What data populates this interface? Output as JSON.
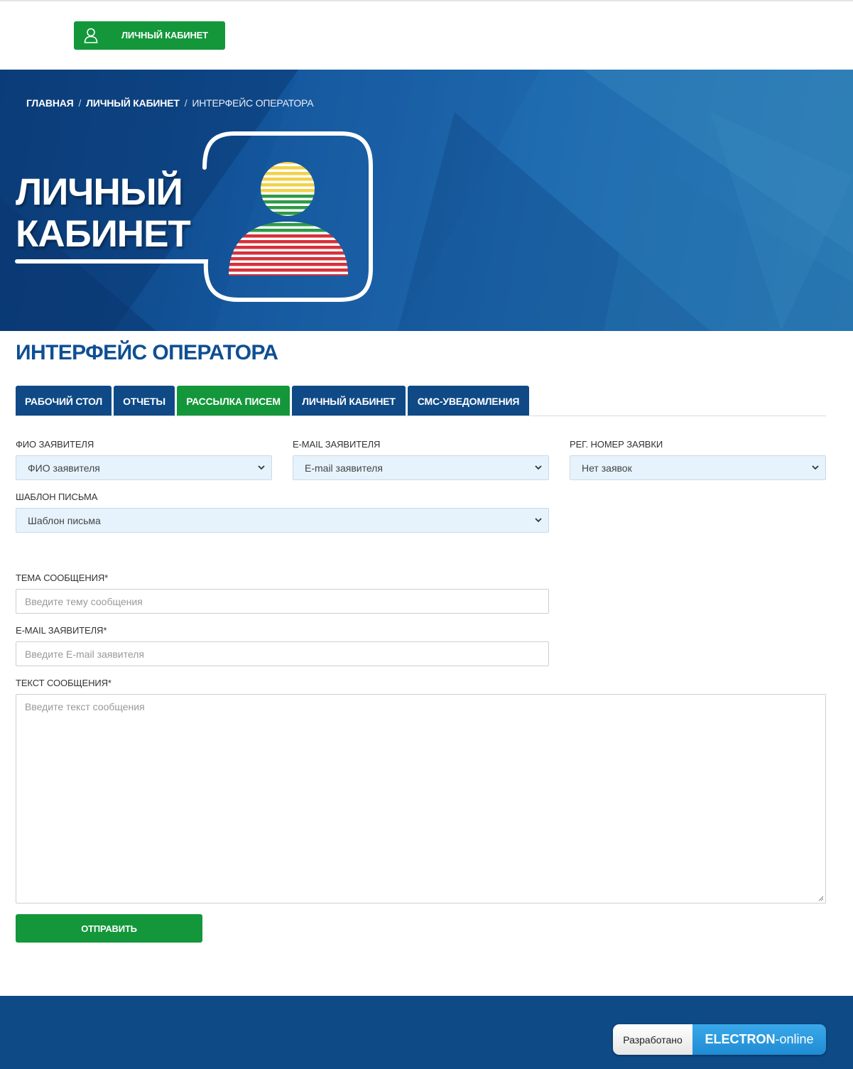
{
  "header": {
    "cabinet_button_label": "ЛИЧНЫЙ КАБИНЕТ"
  },
  "breadcrumb": {
    "items": [
      "ГЛАВНАЯ",
      "ЛИЧНЫЙ КАБИНЕТ",
      "ИНТЕРФЕЙС ОПЕРАТОРА"
    ],
    "separator": "/"
  },
  "banner": {
    "title_line1": "ЛИЧНЫЙ",
    "title_line2": "КАБИНЕТ"
  },
  "page": {
    "title": "ИНТЕРФЕЙС ОПЕРАТОРА"
  },
  "tabs": [
    {
      "label": "РАБОЧИЙ СТОЛ",
      "active": false
    },
    {
      "label": "ОТЧЕТЫ",
      "active": false
    },
    {
      "label": "РАССЫЛКА ПИСЕМ",
      "active": true
    },
    {
      "label": "ЛИЧНЫЙ КАБИНЕТ",
      "active": false
    },
    {
      "label": "СМС-УВЕДОМЛЕНИЯ",
      "active": false
    }
  ],
  "filters": {
    "fio": {
      "label": "ФИО ЗАЯВИТЕЛЯ",
      "value": "ФИО заявителя"
    },
    "email": {
      "label": "E-MAIL ЗАЯВИТЕЛЯ",
      "value": "E-mail заявителя"
    },
    "reg_number": {
      "label": "РЕГ. НОМЕР ЗАЯВКИ",
      "value": "Нет заявок"
    },
    "template": {
      "label": "ШАБЛОН ПИСЬМА",
      "value": "Шаблон письма"
    }
  },
  "form": {
    "subject": {
      "label": "ТЕМА СООБЩЕНИЯ*",
      "placeholder": "Введите тему сообщения"
    },
    "email": {
      "label": "E-MAIL ЗАЯВИТЕЛЯ*",
      "placeholder": "Введите E-mail заявителя"
    },
    "text": {
      "label": "ТЕКСТ СООБЩЕНИЯ*",
      "placeholder": "Введите текст сообщения"
    },
    "submit_label": "ОТПРАВИТЬ"
  },
  "footer": {
    "developed_label": "Разработано",
    "brand_bold": "ELECTRON",
    "brand_rest": "-online"
  },
  "colors": {
    "primary_blue": "#0f4a86",
    "accent_green": "#13973a",
    "select_bg": "#e6f3fc"
  }
}
